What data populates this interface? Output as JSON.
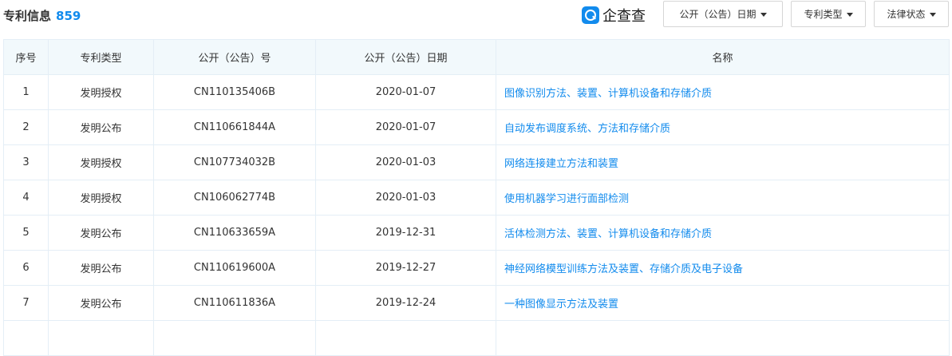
{
  "header": {
    "title": "专利信息",
    "count": "859",
    "logo_text": "企查查",
    "filters": {
      "date_label": "公开（公告）日期",
      "type_label": "专利类型",
      "legal_label": "法律状态"
    }
  },
  "table": {
    "columns": [
      "序号",
      "专利类型",
      "公开（公告）号",
      "公开（公告）日期",
      "名称"
    ],
    "rows": [
      [
        "1",
        "发明授权",
        "CN110135406B",
        "2020-01-07",
        "图像识别方法、装置、计算机设备和存储介质"
      ],
      [
        "2",
        "发明公布",
        "CN110661844A",
        "2020-01-07",
        "自动发布调度系统、方法和存储介质"
      ],
      [
        "3",
        "发明授权",
        "CN107734032B",
        "2020-01-03",
        "网络连接建立方法和装置"
      ],
      [
        "4",
        "发明授权",
        "CN106062774B",
        "2020-01-03",
        "使用机器学习进行面部检测"
      ],
      [
        "5",
        "发明公布",
        "CN110633659A",
        "2019-12-31",
        "活体检测方法、装置、计算机设备和存储介质"
      ],
      [
        "6",
        "发明公布",
        "CN110619600A",
        "2019-12-27",
        "神经网络模型训练方法及装置、存储介质及电子设备"
      ],
      [
        "7",
        "发明公布",
        "CN110611836A",
        "2019-12-24",
        "一种图像显示方法及装置"
      ],
      [
        "",
        "",
        "",
        "",
        ""
      ]
    ]
  },
  "colors": {
    "accent": "#128bed",
    "header_bg": "#f2f9fc",
    "border": "#e4eef6"
  },
  "icons": {
    "logo": "qichacha-logo-icon",
    "dropdown": "caret-down-icon"
  }
}
